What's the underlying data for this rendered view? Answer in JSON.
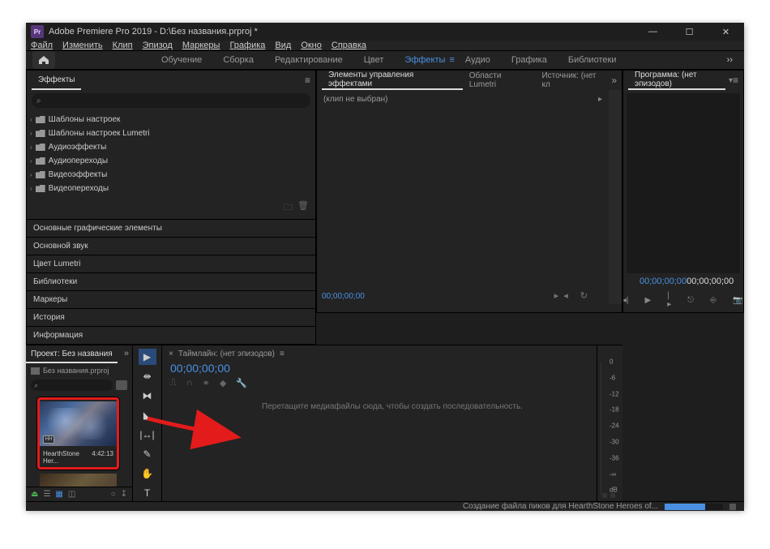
{
  "titlebar": {
    "logo_text": "Pr",
    "title": "Adobe Premiere Pro 2019 - D:\\Без названия.prproj *"
  },
  "menu": {
    "file": "Файл",
    "edit": "Изменить",
    "clip": "Клип",
    "sequence": "Эпизод",
    "markers": "Маркеры",
    "graphics": "Графика",
    "view": "Вид",
    "window": "Окно",
    "help": "Справка"
  },
  "workspaces": {
    "learning": "Обучение",
    "assembly": "Сборка",
    "editing": "Редактирование",
    "color": "Цвет",
    "effects": "Эффекты",
    "audio": "Аудио",
    "graphics": "Графика",
    "libraries": "Библиотеки"
  },
  "effect_controls": {
    "tab1": "Элементы управления эффектами",
    "tab2": "Области Lumetri",
    "tab3": "Источник: (нет кл",
    "empty": "(клип не выбран)",
    "timecode": "00;00;00;00"
  },
  "program": {
    "title": "Программа: (нет эпизодов)",
    "tc_left": "00;00;00;00",
    "tc_right": "00;00;00;00"
  },
  "effects_panel": {
    "title": "Эффекты",
    "search_icon": "⌕",
    "nodes": [
      "Шаблоны настроек",
      "Шаблоны настроек Lumetri",
      "Аудиоэффекты",
      "Аудиопереходы",
      "Видеоэффекты",
      "Видеопереходы"
    ]
  },
  "side_panels": {
    "essential_graphics": "Основные графические элементы",
    "essential_sound": "Основной звук",
    "lumetri_color": "Цвет Lumetri",
    "libraries": "Библиотеки",
    "markers": "Маркеры",
    "history": "История",
    "info": "Информация"
  },
  "project": {
    "tab": "Проект: Без названия",
    "filename": "Без названия.prproj",
    "search_icon": "⌕",
    "clip_name": "HearthStone  Her...",
    "clip_dur": "4:42:13",
    "clip_badge": "HH"
  },
  "timeline": {
    "tab": "Таймлайн: (нет эпизодов)",
    "tc": "00;00;00;00",
    "drop_hint": "Перетащите медиафайлы сюда, чтобы создать последовательность."
  },
  "meter": {
    "marks": [
      "0",
      "-6",
      "-12",
      "-18",
      "-24",
      "-30",
      "-36",
      "-∞",
      "dB"
    ]
  },
  "status": {
    "text": "Создание файла пиков для HearthStone  Heroes of..."
  },
  "tools": {
    "selection": "▶",
    "track_select": "⇼",
    "ripple": "⧓",
    "razor": "◣",
    "slip": "|↔|",
    "pen": "✎",
    "hand": "✋",
    "type": "T"
  }
}
